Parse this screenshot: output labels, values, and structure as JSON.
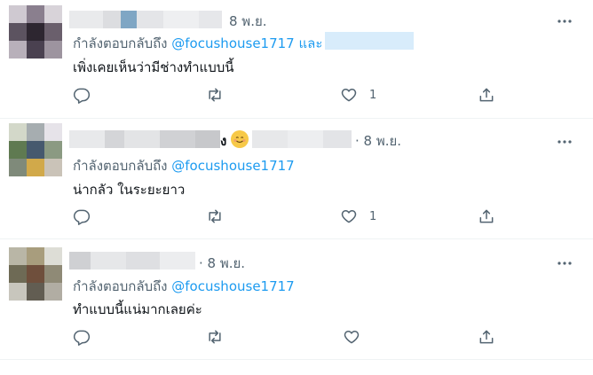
{
  "colors": {
    "accent": "#1d9bf0",
    "secondary_text": "#536471",
    "divider": "#eff3f4"
  },
  "tweets": [
    {
      "date": "8 พ.ย.",
      "reply_prefix": "กำลังตอบกลับถึง",
      "mention": "@focushouse1717",
      "reply_and": "และ",
      "text": "เพิ่งเคยเห็นว่ามีช่างทำแบบนี้",
      "like_count": "1"
    },
    {
      "date": "· 8 พ.ย.",
      "name_fragment": "ง",
      "reply_prefix": "กำลังตอบกลับถึง",
      "mention": "@focushouse1717",
      "text": "น่ากลัว ในระยะยาว",
      "like_count": "1"
    },
    {
      "date": "· 8 พ.ย.",
      "reply_prefix": "กำลังตอบกลับถึง",
      "mention": "@focushouse1717",
      "text": "ทำแบบนี้แน่มากเลยค่ะ",
      "like_count": ""
    }
  ],
  "icons": [
    "reply-icon",
    "retweet-icon",
    "like-icon",
    "share-icon",
    "more-icon",
    "smile-emoji-icon"
  ]
}
